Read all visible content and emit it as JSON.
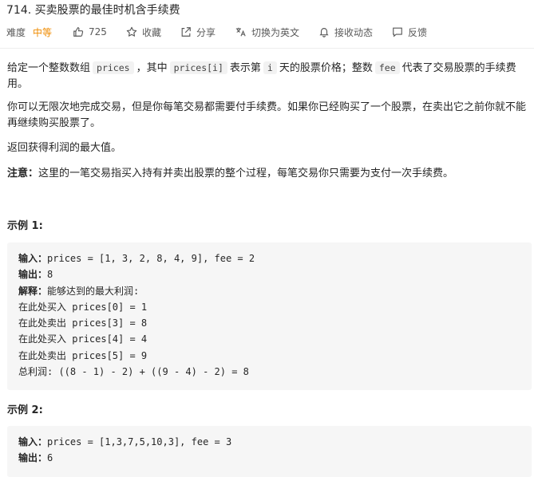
{
  "problem": {
    "title": "714. 买卖股票的最佳时机含手续费",
    "difficulty_label": "难度",
    "difficulty_value": "中等",
    "likes": "725",
    "actions": {
      "favorite": "收藏",
      "share": "分享",
      "switch_lang": "切换为英文",
      "notify": "接收动态",
      "feedback": "反馈"
    }
  },
  "description": {
    "p1_a": "给定一个整数数组",
    "p1_code1": "prices",
    "p1_b": "，其中",
    "p1_code2": "prices[i]",
    "p1_c": "表示第",
    "p1_code3": "i",
    "p1_d": "天的股票价格；整数",
    "p1_code4": "fee",
    "p1_e": "代表了交易股票的手续费用。",
    "p2": "你可以无限次地完成交易，但是你每笔交易都需要付手续费。如果你已经购买了一个股票，在卖出它之前你就不能再继续购买股票了。",
    "p3": "返回获得利润的最大值。",
    "note_label": "注意：",
    "note_text": "这里的一笔交易指买入持有并卖出股票的整个过程，每笔交易你只需要为支付一次手续费。"
  },
  "examples": [
    {
      "title": "示例 1:",
      "input_label": "输入：",
      "input_value": "prices = [1, 3, 2, 8, 4, 9], fee = 2",
      "output_label": "输出：",
      "output_value": "8",
      "explain_label": "解释：",
      "explain_value": "能够达到的最大利润:",
      "steps": [
        "在此处买入 prices[0] = 1",
        "在此处卖出 prices[3] = 8",
        "在此处买入 prices[4] = 4",
        "在此处卖出 prices[5] = 9",
        "总利润: ((8 - 1) - 2) + ((9 - 4) - 2) = 8"
      ]
    },
    {
      "title": "示例 2:",
      "input_label": "输入：",
      "input_value": "prices = [1,3,7,5,10,3], fee = 3",
      "output_label": "输出：",
      "output_value": "6"
    }
  ]
}
